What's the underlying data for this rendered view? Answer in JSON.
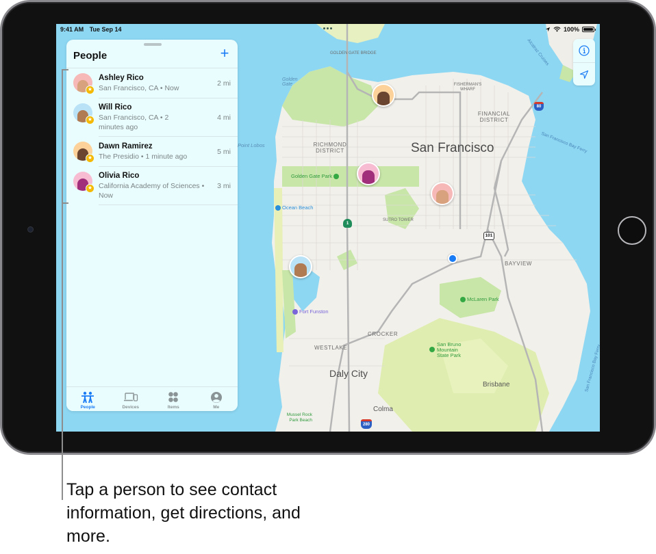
{
  "status_bar": {
    "time": "9:41 AM",
    "date": "Tue Sep 14",
    "battery": "100%",
    "battery_level": 1.0,
    "icons": [
      "location-arrow-icon",
      "wifi-icon",
      "battery-icon"
    ]
  },
  "people_panel": {
    "title": "People",
    "add_icon": "plus-icon",
    "people": [
      {
        "name": "Ashley Rico",
        "location": "San Francisco, CA • Now",
        "distance": "2 mi",
        "avatar_color": "#f7b8b8",
        "face_color": "#d9a27e"
      },
      {
        "name": "Will Rico",
        "location": "San Francisco, CA • 2 minutes ago",
        "distance": "4 mi",
        "avatar_color": "#b9e2f7",
        "face_color": "#b07a52"
      },
      {
        "name": "Dawn Ramirez",
        "location": "The Presidio • 1 minute ago",
        "distance": "5 mi",
        "avatar_color": "#fcd29a",
        "face_color": "#6b4530"
      },
      {
        "name": "Olivia Rico",
        "location": "California Academy of Sciences • Now",
        "distance": "3 mi",
        "avatar_color": "#f7bcd2",
        "face_color": "#a02e7a"
      }
    ]
  },
  "tab_bar": {
    "tabs": [
      {
        "label": "People",
        "icon": "people-icon",
        "active": true
      },
      {
        "label": "Devices",
        "icon": "devices-icon",
        "active": false
      },
      {
        "label": "Items",
        "icon": "items-icon",
        "active": false
      },
      {
        "label": "Me",
        "icon": "person-circle-icon",
        "active": false
      }
    ]
  },
  "map_controls": {
    "info_icon": "info-icon",
    "location_icon": "location-arrow-icon"
  },
  "map": {
    "labels": {
      "golden_gate_bridge": "GOLDEN GATE BRIDGE",
      "golden_gate": "Golden Gate",
      "alcatraz": "Alcatraz Cruises",
      "fishermans_wharf": "FISHERMAN'S WHARF",
      "financial_district": "FINANCIAL DISTRICT",
      "sf_bay_ferry": "San Francisco Bay Ferry",
      "san_francisco": "San Francisco",
      "point_lobos": "Point Lobos",
      "richmond_district": "RICHMOND DISTRICT",
      "golden_gate_park": "Golden Gate Park",
      "ocean_beach": "Ocean Beach",
      "sutro_tower": "SUTRO TOWER",
      "bayview": "BAYVIEW",
      "mclaren_park": "McLaren Park",
      "fort_funston": "Fort Funston",
      "crocker": "CROCKER",
      "westlake": "WESTLAKE",
      "san_bruno": "San Bruno Mountain State Park",
      "daly_city": "Daly City",
      "brisbane": "Brisbane",
      "colma": "Colma",
      "mussel_rock": "Mussel Rock Park Beach",
      "sf_bay_ferry_2": "San Francisco Bay Ferry"
    },
    "shields": {
      "i80": "80",
      "us101": "101",
      "ca1": "1",
      "i280": "280"
    }
  },
  "callout": {
    "text": "Tap a person to see contact information, get directions, and more."
  },
  "colors": {
    "accent": "#1a7cf5",
    "water": "#8dd7f3",
    "land": "#f2f0eb",
    "park": "#c8e6a8",
    "badge": "#f5b800"
  }
}
